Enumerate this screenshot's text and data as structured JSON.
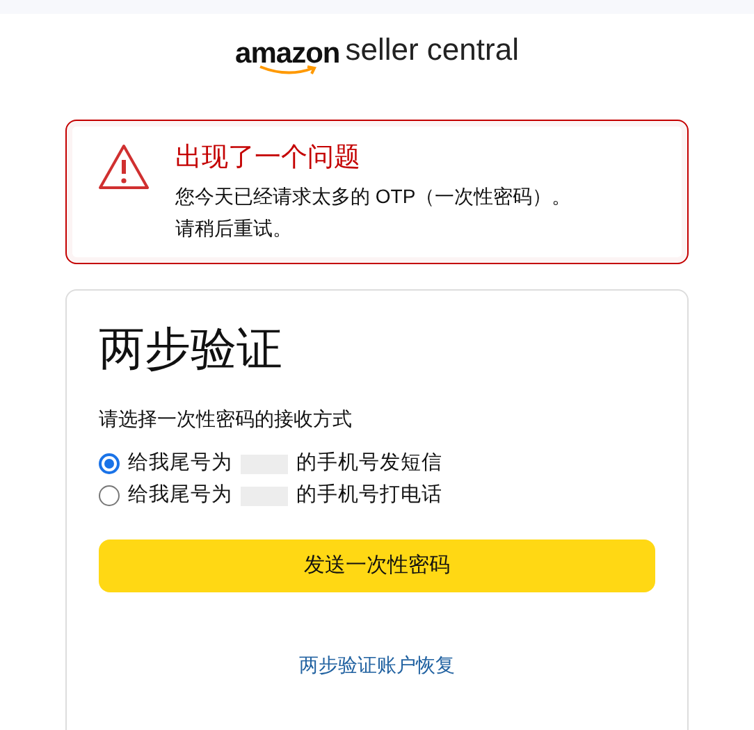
{
  "logo": {
    "brand": "amazon",
    "product": "seller central"
  },
  "alert": {
    "title": "出现了一个问题",
    "message": "您今天已经请求太多的 OTP（一次性密码）。",
    "hint": "请稍后重试。"
  },
  "card": {
    "title": "两步验证",
    "prompt": "请选择一次性密码的接收方式",
    "options": [
      {
        "before": "给我尾号为",
        "after": "的手机号发短信",
        "selected": true
      },
      {
        "before": "给我尾号为",
        "after": "的手机号打电话",
        "selected": false
      }
    ],
    "button": "发送一次性密码",
    "link": "两步验证账户恢复"
  }
}
